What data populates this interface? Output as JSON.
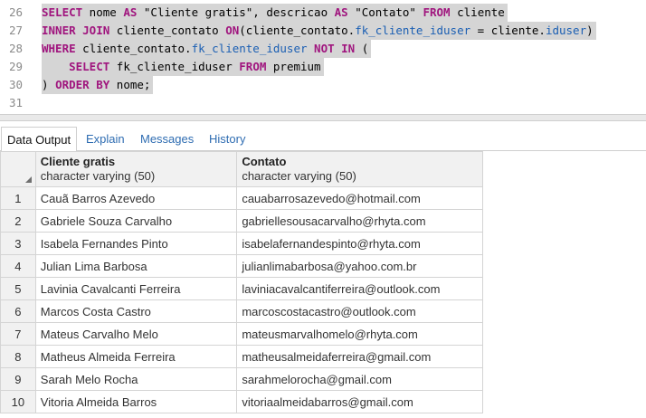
{
  "editor": {
    "lines": [
      {
        "number": "26",
        "tokens": [
          {
            "t": "SELECT",
            "c": "kw"
          },
          {
            "t": " nome ",
            "c": ""
          },
          {
            "t": "AS",
            "c": "kw"
          },
          {
            "t": " \"Cliente gratis\", descricao ",
            "c": ""
          },
          {
            "t": "AS",
            "c": "kw"
          },
          {
            "t": " \"Contato\" ",
            "c": ""
          },
          {
            "t": "FROM",
            "c": "kw"
          },
          {
            "t": " cliente",
            "c": ""
          }
        ]
      },
      {
        "number": "27",
        "tokens": [
          {
            "t": "INNER JOIN",
            "c": "kw"
          },
          {
            "t": " cliente_contato ",
            "c": ""
          },
          {
            "t": "ON",
            "c": "kw"
          },
          {
            "t": "(cliente_contato.",
            "c": ""
          },
          {
            "t": "fk_cliente_iduser",
            "c": "col"
          },
          {
            "t": " = cliente.",
            "c": ""
          },
          {
            "t": "iduser",
            "c": "col"
          },
          {
            "t": ")",
            "c": ""
          }
        ]
      },
      {
        "number": "28",
        "tokens": [
          {
            "t": "WHERE",
            "c": "kw"
          },
          {
            "t": " cliente_contato.",
            "c": ""
          },
          {
            "t": "fk_cliente_iduser",
            "c": "col"
          },
          {
            "t": " ",
            "c": ""
          },
          {
            "t": "NOT IN",
            "c": "kw"
          },
          {
            "t": " (",
            "c": ""
          }
        ]
      },
      {
        "number": "29",
        "tokens": [
          {
            "t": "    ",
            "c": ""
          },
          {
            "t": "SELECT",
            "c": "kw"
          },
          {
            "t": " fk_cliente_iduser ",
            "c": ""
          },
          {
            "t": "FROM",
            "c": "kw"
          },
          {
            "t": " premium",
            "c": ""
          }
        ]
      },
      {
        "number": "30",
        "tokens": [
          {
            "t": ") ",
            "c": ""
          },
          {
            "t": "ORDER BY",
            "c": "kw"
          },
          {
            "t": " nome;",
            "c": ""
          }
        ]
      },
      {
        "number": "31",
        "tokens": []
      }
    ]
  },
  "tabs": [
    {
      "label": "Data Output",
      "active": true
    },
    {
      "label": "Explain",
      "active": false
    },
    {
      "label": "Messages",
      "active": false
    },
    {
      "label": "History",
      "active": false
    }
  ],
  "grid": {
    "columns": [
      {
        "name": "Cliente gratis",
        "type": "character varying (50)"
      },
      {
        "name": "Contato",
        "type": "character varying (50)"
      }
    ],
    "rows": [
      {
        "n": "1",
        "name": "Cauã Barros Azevedo",
        "contact": "cauabarrosazevedo@hotmail.com"
      },
      {
        "n": "2",
        "name": "Gabriele Souza Carvalho",
        "contact": "gabriellesousacarvalho@rhyta.com"
      },
      {
        "n": "3",
        "name": "Isabela Fernandes Pinto",
        "contact": "isabelafernandespinto@rhyta.com"
      },
      {
        "n": "4",
        "name": "Julian Lima Barbosa",
        "contact": "julianlimabarbosa@yahoo.com.br"
      },
      {
        "n": "5",
        "name": "Lavinia Cavalcanti Ferreira",
        "contact": "laviniacavalcantiferreira@outlook.com"
      },
      {
        "n": "6",
        "name": "Marcos Costa Castro",
        "contact": "marcoscostacastro@outlook.com"
      },
      {
        "n": "7",
        "name": "Mateus Carvalho Melo",
        "contact": "mateusmarvalhomelo@rhyta.com"
      },
      {
        "n": "8",
        "name": "Matheus Almeida Ferreira",
        "contact": "matheusalmeidaferreira@gmail.com"
      },
      {
        "n": "9",
        "name": "Sarah Melo Rocha",
        "contact": "sarahmelorocha@gmail.com"
      },
      {
        "n": "10",
        "name": "Vitoria Almeida Barros",
        "contact": "vitoriaalmeidabarros@gmail.com"
      }
    ]
  }
}
